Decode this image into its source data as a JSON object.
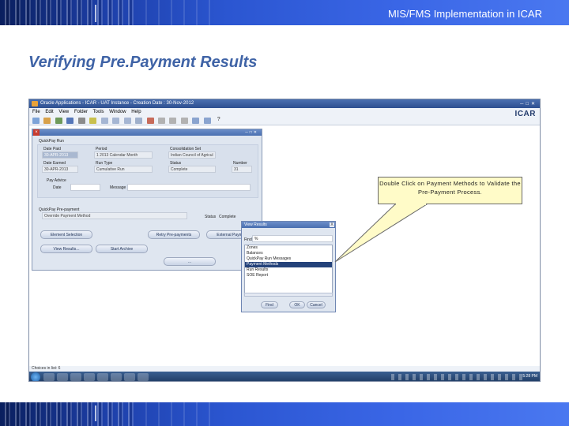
{
  "slide": {
    "header_text": "MIS/FMS Implementation in ICAR",
    "title": "Verifying Pre.Payment Results",
    "callout": "Double Click on Payment Methods to Validate the Pre-Payment Process."
  },
  "app": {
    "window_title": "Oracle Applications - ICAR - UAT Instance - Creation Date : 30-Nov-2012",
    "logo": "ICAR",
    "menu": [
      "File",
      "Edit",
      "View",
      "Folder",
      "Tools",
      "Window",
      "Help"
    ],
    "toolbar_icons": [
      "new-icon",
      "find-icon",
      "nav-icon",
      "save-icon",
      "print-icon",
      "close-form-icon",
      "cut-icon",
      "copy-icon",
      "paste-icon",
      "clear-icon",
      "delete-icon",
      "edit-icon",
      "zoom-icon",
      "translate-icon",
      "attach-icon",
      "folder-icon",
      "help-icon"
    ],
    "help_glyph": "?",
    "status_text": "Choices in list: 6",
    "clock": "5:28 PM"
  },
  "form": {
    "section_run": "QuickPay Run",
    "date_paid_label": "Date Paid",
    "date_paid": "30-APR-2013",
    "period_label": "Period",
    "period": "1 2013 Calendar Month",
    "consolidation_label": "Consolidation Set",
    "consolidation": "Indian Council of Agricul",
    "date_earned_label": "Date Earned",
    "date_earned": "30-APR-2013",
    "run_type_label": "Run Type",
    "run_type": "Cumulative Run",
    "status_label": "Status",
    "status": "Complete",
    "number_label": "Number",
    "number": "31",
    "pay_advice_label": "Pay Advice",
    "date_label": "Date",
    "message_label": "Message",
    "section_prepay": "QuickPay Pre-payment",
    "override_label": "Override Payment Method",
    "prepay_status_label": "Status",
    "prepay_status": "Complete",
    "buttons": {
      "element_selection": "Element Selection",
      "retry_prepayments": "Retry Pre-payments",
      "external_payment": "External Payment",
      "view_results": "View Results...",
      "start_archive": "Start Archive",
      "hidden": "..."
    }
  },
  "dialog": {
    "title": "View Results",
    "close": "X",
    "find_label": "Find",
    "find_value": "%",
    "items": [
      "Zones",
      "Balances",
      "QuickPay Run Messages",
      "Payment Methods",
      "Run Results",
      "SOE Report"
    ],
    "selected_index": 3,
    "find_button": "Find",
    "ok_button": "OK",
    "cancel_button": "Cancel"
  }
}
